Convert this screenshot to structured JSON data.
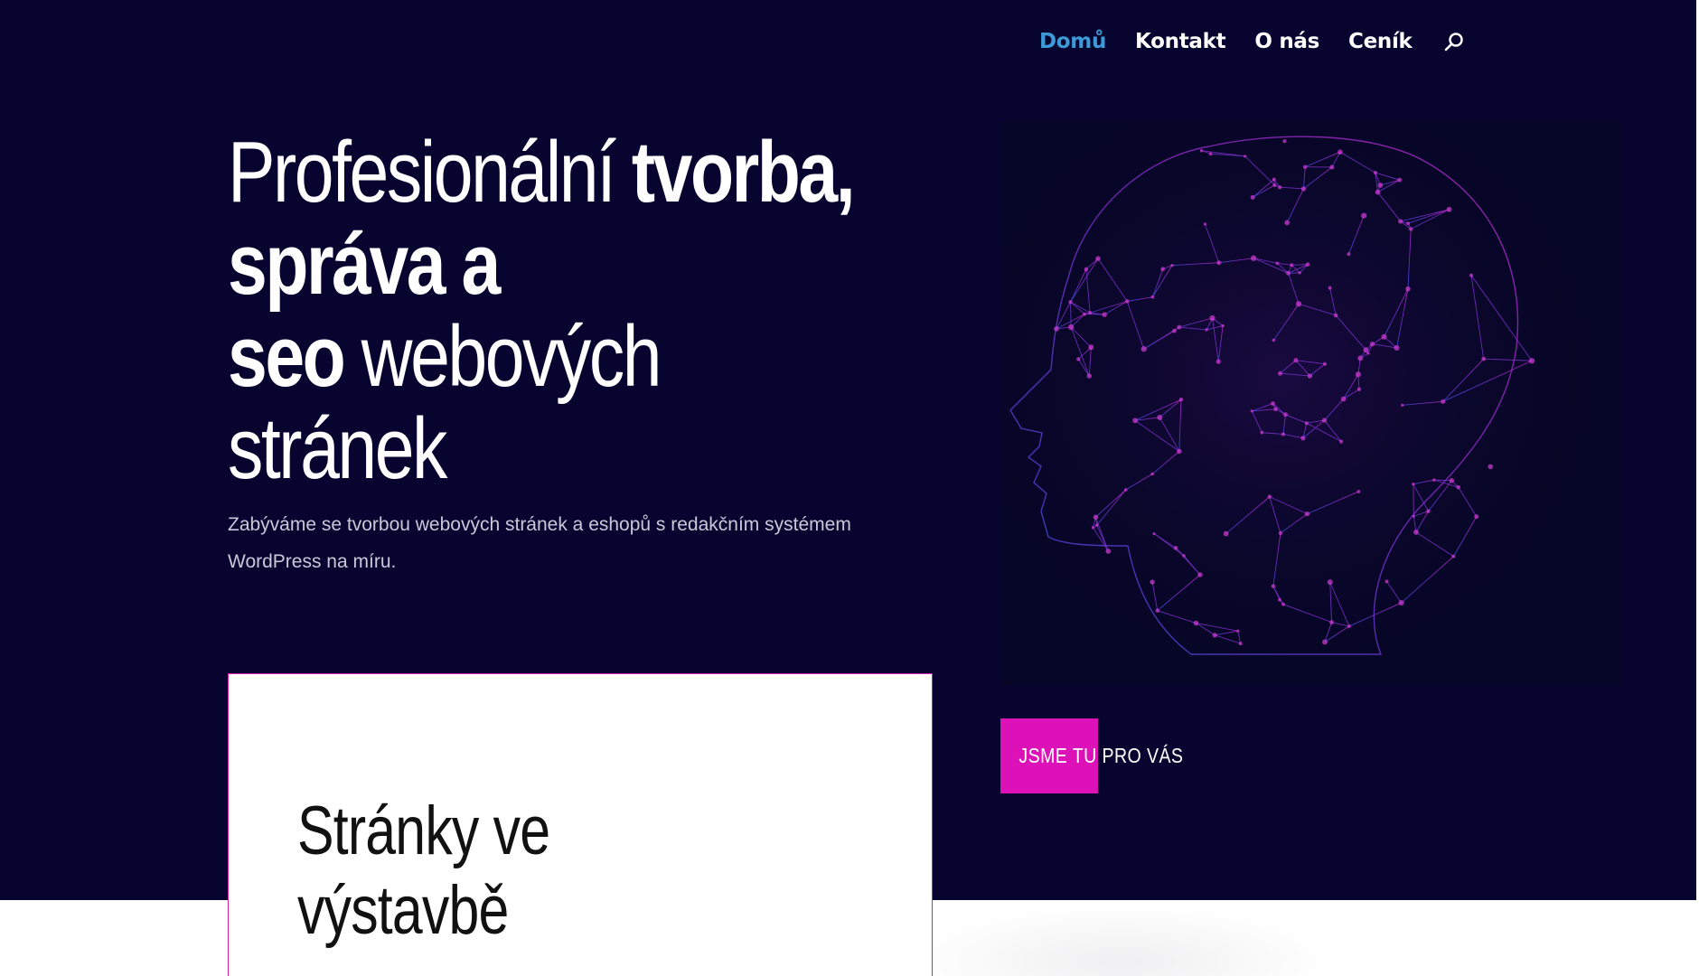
{
  "colors": {
    "hero_background": "#070530",
    "nav_active": "#3d9ad9",
    "accent_pink": "#dc12b8",
    "mesh_purple": "#c22bd0",
    "mesh_blue": "#3b52e8"
  },
  "nav": {
    "items": [
      {
        "label": "Domů",
        "active": true
      },
      {
        "label": "Kontakt",
        "active": false
      },
      {
        "label": "O nás",
        "active": false
      },
      {
        "label": "Ceník",
        "active": false
      }
    ],
    "search_icon": "search-icon"
  },
  "hero": {
    "headline_part1": "Profesionální ",
    "headline_part2": "tvorba,",
    "headline_part3": "správa a",
    "headline_part4": "seo",
    "headline_part5": " webových",
    "headline_part6": "stránek",
    "subtitle": "Zabýváme se tvorbou webových stránek a eshopů s redakčním systémem WordPress na míru.",
    "illustration": "polygonal-head-illustration"
  },
  "cta": {
    "label": "JSME TU PRO VÁS"
  },
  "card": {
    "title_line1": "Stránky ve",
    "title_line2": "výstavbě"
  }
}
